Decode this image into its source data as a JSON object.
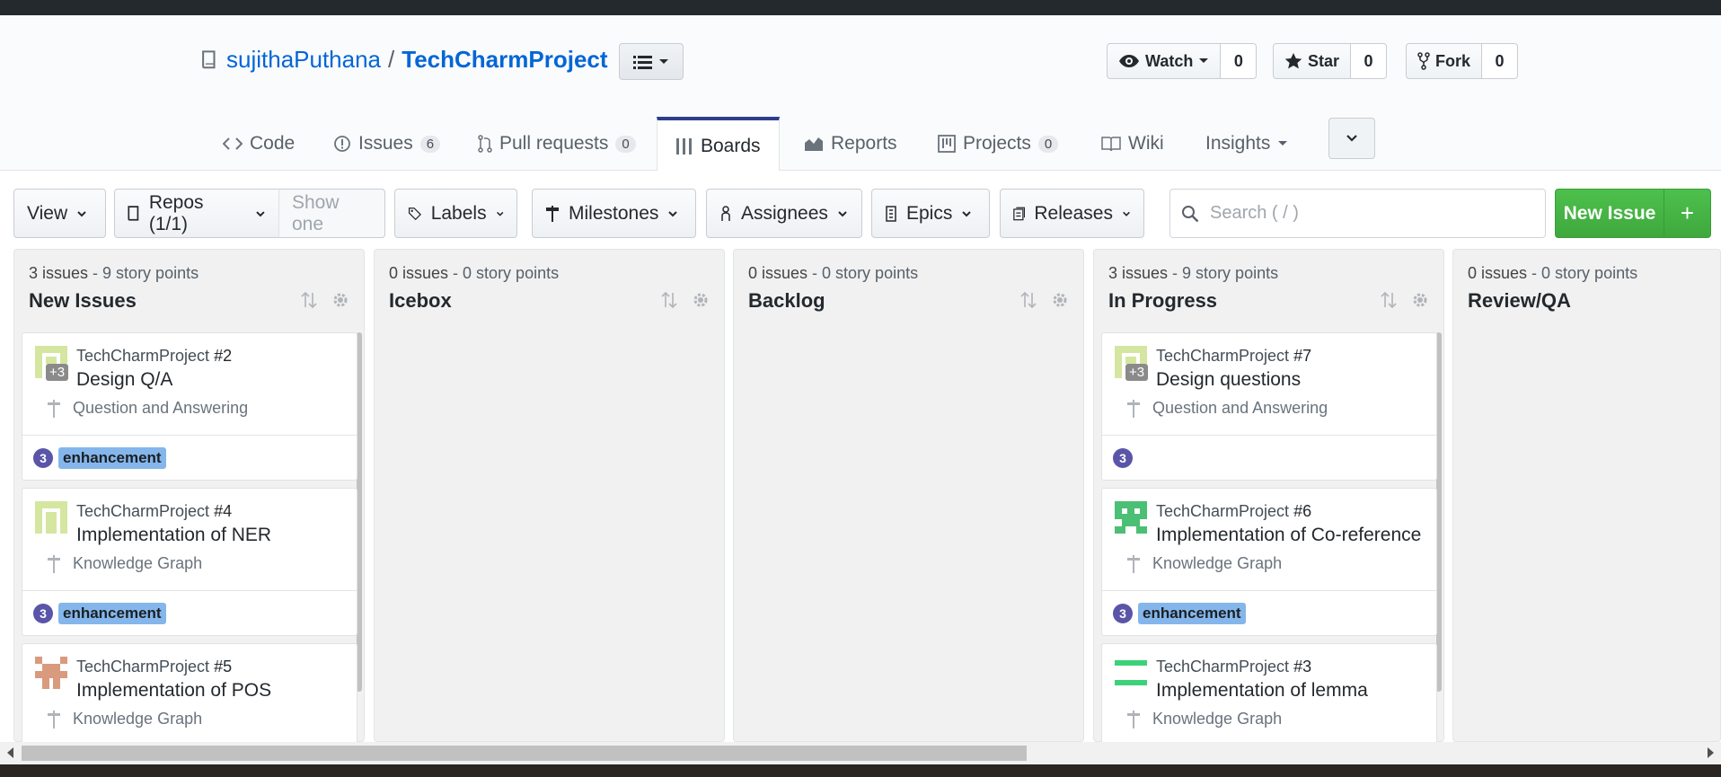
{
  "repo": {
    "owner": "sujithaPuthana",
    "separator": "/",
    "name": "TechCharmProject"
  },
  "social": [
    {
      "key": "watch",
      "label": "Watch",
      "count": "0"
    },
    {
      "key": "star",
      "label": "Star",
      "count": "0"
    },
    {
      "key": "fork",
      "label": "Fork",
      "count": "0"
    }
  ],
  "tabs": {
    "code": "Code",
    "issues": "Issues",
    "issues_count": "6",
    "pulls": "Pull requests",
    "pulls_count": "0",
    "boards": "Boards",
    "reports": "Reports",
    "projects": "Projects",
    "projects_count": "0",
    "wiki": "Wiki",
    "insights": "Insights"
  },
  "filters": {
    "view": "View",
    "repos": "Repos (1/1)",
    "show_one": "Show one",
    "labels": "Labels",
    "milestones": "Milestones",
    "assignees": "Assignees",
    "epics": "Epics",
    "releases": "Releases",
    "search_placeholder": "Search ( / )",
    "new_issue": "New Issue",
    "new_issue_plus": "+"
  },
  "columns": [
    {
      "issues": "3 issues",
      "points": " - 9 story points",
      "title": "New Issues"
    },
    {
      "issues": "0 issues",
      "points": " - 0 story points",
      "title": "Icebox"
    },
    {
      "issues": "0 issues",
      "points": " - 0 story points",
      "title": "Backlog"
    },
    {
      "issues": "3 issues",
      "points": " - 9 story points",
      "title": "In Progress"
    },
    {
      "issues": "0 issues",
      "points": " - 0 story points",
      "title": "Review/QA"
    }
  ],
  "cards": {
    "new_issues": [
      {
        "repo": "TechCharmProject",
        "number": "#2",
        "title": "Design Q/A",
        "milestone": "Question and Answering",
        "points": "3",
        "label": "enhancement",
        "extra_assignees": "+3"
      },
      {
        "repo": "TechCharmProject",
        "number": "#4",
        "title": "Implementation of NER",
        "milestone": "Knowledge Graph",
        "points": "3",
        "label": "enhancement"
      },
      {
        "repo": "TechCharmProject",
        "number": "#5",
        "title": "Implementation of POS",
        "milestone": "Knowledge Graph"
      }
    ],
    "in_progress": [
      {
        "repo": "TechCharmProject",
        "number": "#7",
        "title": "Design questions",
        "milestone": "Question and Answering",
        "points": "3",
        "extra_assignees": "+3"
      },
      {
        "repo": "TechCharmProject",
        "number": "#6",
        "title": "Implementation of Co-reference",
        "milestone": "Knowledge Graph",
        "points": "3",
        "label": "enhancement"
      },
      {
        "repo": "TechCharmProject",
        "number": "#3",
        "title": "Implementation of lemma",
        "milestone": "Knowledge Graph"
      }
    ]
  },
  "colors": {
    "link": "#0366d6",
    "green": "#4dc04c",
    "label": "#84b6eb",
    "points": "#5a55a8",
    "active_tab": "#2c3e8c"
  }
}
